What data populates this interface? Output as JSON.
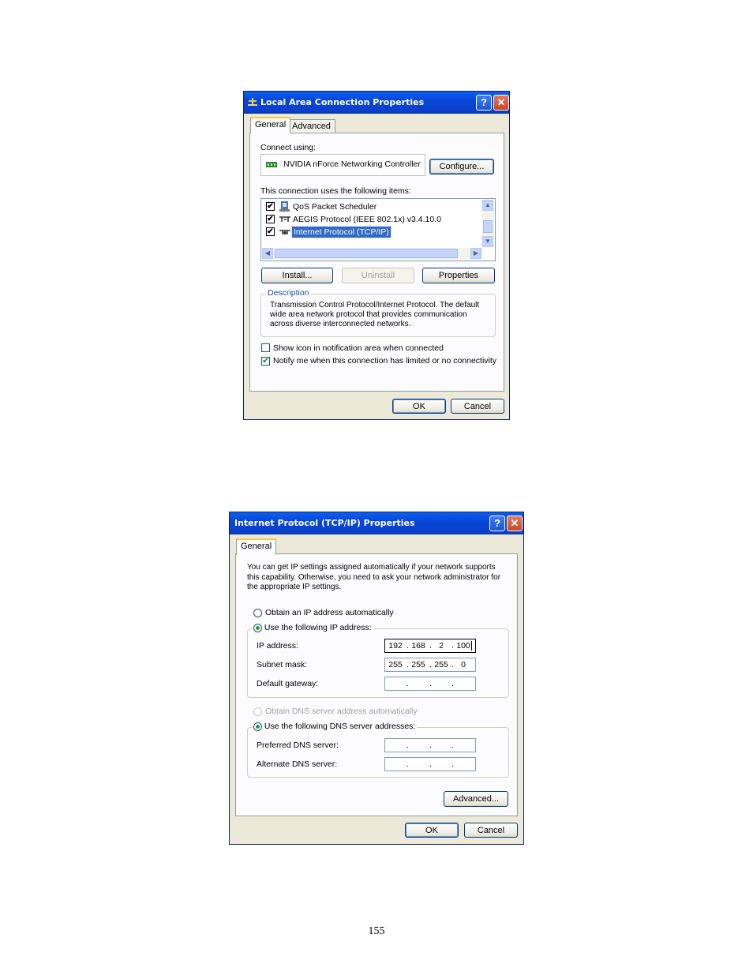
{
  "dialog1": {
    "title": "Local Area Connection Properties",
    "tabs": [
      "General",
      "Advanced"
    ],
    "connect_using_label": "Connect using:",
    "adapter_name": "NVIDIA nForce Networking Controller",
    "configure_label": "Configure...",
    "items_label": "This connection uses the following items:",
    "items": [
      {
        "label": "QoS Packet Scheduler",
        "checked": true,
        "selected": false
      },
      {
        "label": "AEGIS Protocol (IEEE 802.1x) v3.4.10.0",
        "checked": true,
        "selected": false
      },
      {
        "label": "Internet Protocol (TCP/IP)",
        "checked": true,
        "selected": true
      }
    ],
    "install_label": "Install...",
    "uninstall_label": "Uninstall",
    "properties_label": "Properties",
    "description_title": "Description",
    "description_text": "Transmission Control Protocol/Internet Protocol. The default wide area network protocol that provides communication across diverse interconnected networks.",
    "show_icon_label": "Show icon in notification area when connected",
    "show_icon_checked": false,
    "notify_label": "Notify me when this connection has limited or no connectivity",
    "notify_checked": true,
    "ok_label": "OK",
    "cancel_label": "Cancel"
  },
  "dialog2": {
    "title": "Internet Protocol (TCP/IP) Properties",
    "tab": "General",
    "intro_text": "You can get IP settings assigned automatically if your network supports this capability. Otherwise, you need to ask your network administrator for the appropriate IP settings.",
    "obtain_ip_label": "Obtain an IP address automatically",
    "use_ip_label": "Use the following IP address:",
    "ip_address_label": "IP address:",
    "ip_address": [
      "192",
      "168",
      "2",
      "100"
    ],
    "subnet_label": "Subnet mask:",
    "subnet": [
      "255",
      "255",
      "255",
      "0"
    ],
    "gateway_label": "Default gateway:",
    "gateway": [
      "",
      "",
      "",
      ""
    ],
    "obtain_dns_label": "Obtain DNS server address automatically",
    "use_dns_label": "Use the following DNS server addresses:",
    "preferred_dns_label": "Preferred DNS server:",
    "preferred_dns": [
      "",
      "",
      "",
      ""
    ],
    "alternate_dns_label": "Alternate DNS server:",
    "alternate_dns": [
      "",
      "",
      "",
      ""
    ],
    "advanced_label": "Advanced...",
    "ok_label": "OK",
    "cancel_label": "Cancel"
  },
  "page_number": "155",
  "colors": {
    "titlebar": "#0846d8",
    "selection": "#316ac5",
    "check": "#21a121"
  }
}
